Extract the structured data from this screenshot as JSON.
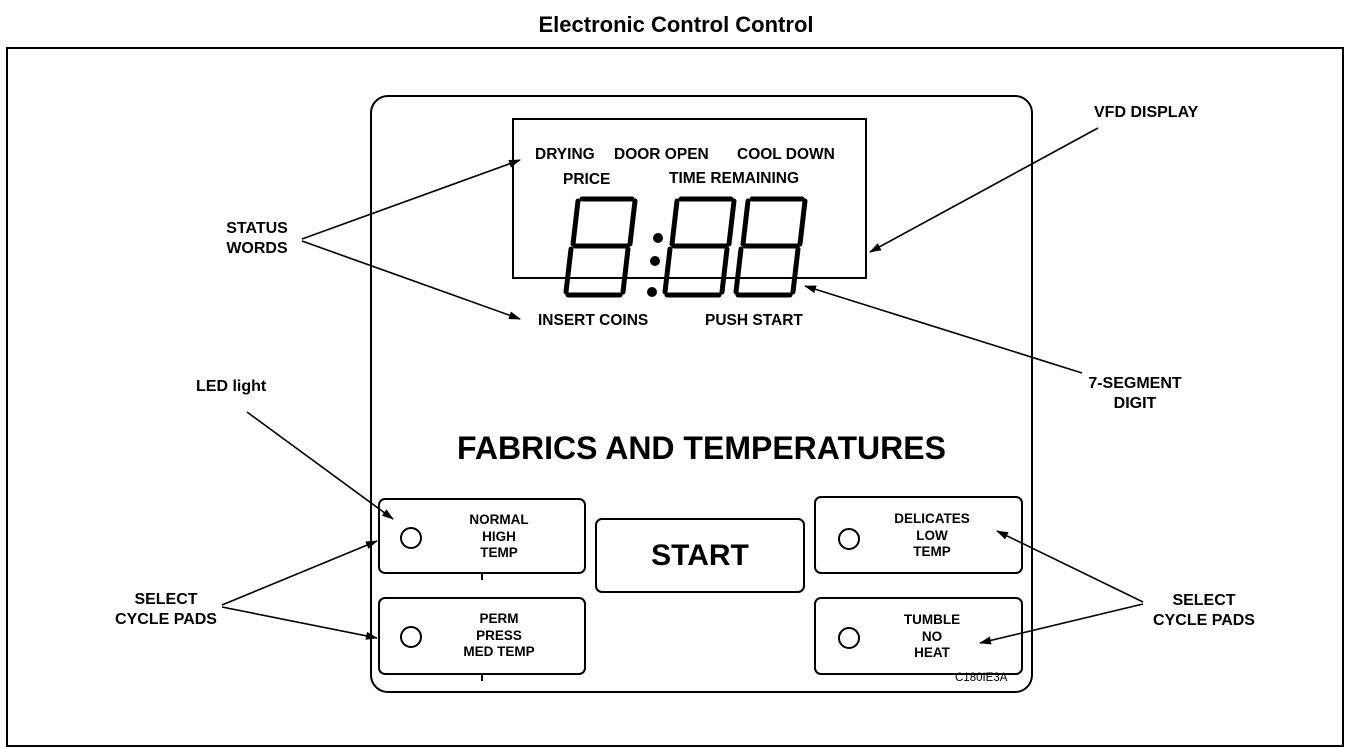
{
  "title": "Electronic Control Control",
  "display": {
    "status_words_top": [
      "DRYING",
      "DOOR OPEN",
      "COOL DOWN"
    ],
    "status_words_mid": [
      "PRICE",
      "TIME REMAINING"
    ],
    "status_words_bottom": [
      "INSERT COINS",
      "PUSH START"
    ],
    "digits": "8:88"
  },
  "callouts": {
    "vfd_display": "VFD DISPLAY",
    "status_words": [
      "STATUS",
      "WORDS"
    ],
    "seven_segment": [
      "7-SEGMENT",
      "DIGIT"
    ],
    "led_light": "LED light",
    "select_cycle_pads_left": [
      "SELECT",
      "CYCLE PADS"
    ],
    "select_cycle_pads_right": [
      "SELECT",
      "CYCLE PADS"
    ]
  },
  "panel": {
    "heading": "FABRICS AND TEMPERATURES",
    "start_label": "START",
    "pads": {
      "normal": [
        "NORMAL",
        "HIGH",
        "TEMP"
      ],
      "perm_press": [
        "PERM",
        "PRESS",
        "MED TEMP"
      ],
      "delicates": [
        "DELICATES",
        "LOW",
        "TEMP"
      ],
      "tumble": [
        "TUMBLE",
        "NO",
        "HEAT"
      ]
    }
  },
  "figure_id": "C180IE3A"
}
